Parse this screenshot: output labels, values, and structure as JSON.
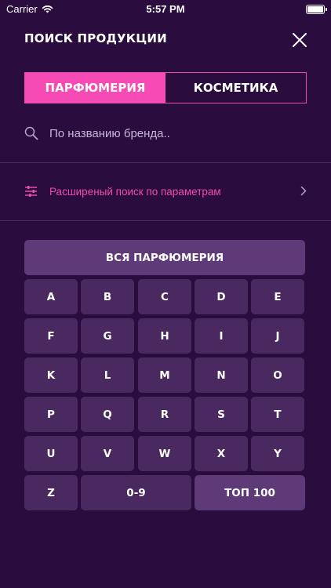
{
  "status": {
    "carrier": "Carrier",
    "time": "5:57 PM",
    "battery": 1.0
  },
  "header": {
    "title": "ПОИСК ПРОДУКЦИИ"
  },
  "tabs": [
    {
      "label": "ПАРФЮМЕРИЯ",
      "active": true
    },
    {
      "label": "КОСМЕТИКА",
      "active": false
    }
  ],
  "search": {
    "placeholder": "По названию бренда..",
    "value": ""
  },
  "advanced": {
    "label": "Расширеный поиск по параметрам"
  },
  "keyboard": {
    "all_label": "ВСЯ ПАРФЮМЕРИЯ",
    "letters": [
      "A",
      "B",
      "C",
      "D",
      "E",
      "F",
      "G",
      "H",
      "I",
      "J",
      "K",
      "L",
      "M",
      "N",
      "O",
      "P",
      "Q",
      "R",
      "S",
      "T",
      "U",
      "V",
      "W",
      "X",
      "Y",
      "Z"
    ],
    "digits_label": "0-9",
    "top_label": "ТОП 100"
  },
  "colors": {
    "background": "#2a0c3f",
    "accent": "#f64bb5",
    "key": "#4a2960",
    "key_accent": "#5e3a78"
  }
}
